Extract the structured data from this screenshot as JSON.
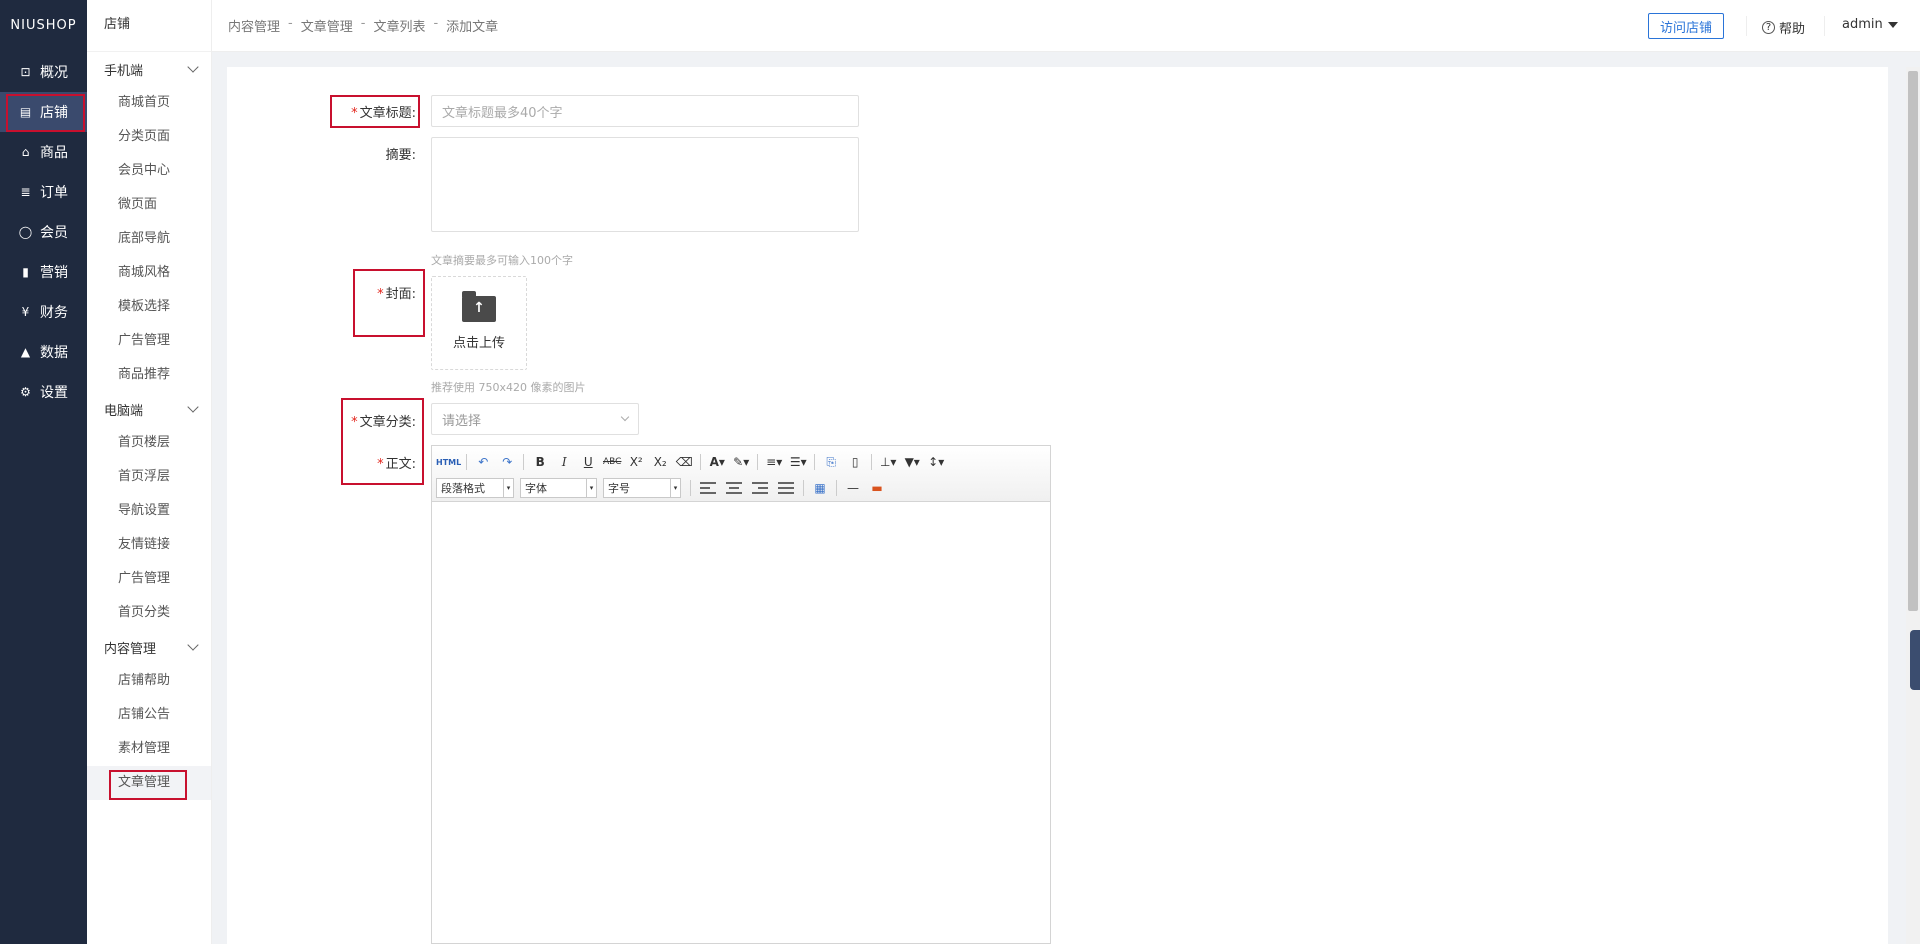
{
  "logo": "NIUSHOP",
  "main_nav": [
    {
      "label": "概况",
      "icon": "overview-icon",
      "glyph": "⊡"
    },
    {
      "label": "店铺",
      "icon": "store-icon",
      "glyph": "▤"
    },
    {
      "label": "商品",
      "icon": "goods-icon",
      "glyph": "⌂"
    },
    {
      "label": "订单",
      "icon": "order-icon",
      "glyph": "≣"
    },
    {
      "label": "会员",
      "icon": "member-icon",
      "glyph": "◯"
    },
    {
      "label": "营销",
      "icon": "marketing-icon",
      "glyph": "▮"
    },
    {
      "label": "财务",
      "icon": "finance-icon",
      "glyph": "¥"
    },
    {
      "label": "数据",
      "icon": "data-icon",
      "glyph": "▲"
    },
    {
      "label": "设置",
      "icon": "settings-icon",
      "glyph": "⚙"
    }
  ],
  "subnav": {
    "title": "店铺",
    "groups": [
      {
        "label": "手机端",
        "items": [
          "商城首页",
          "分类页面",
          "会员中心",
          "微页面",
          "底部导航",
          "商城风格",
          "模板选择",
          "广告管理",
          "商品推荐"
        ]
      },
      {
        "label": "电脑端",
        "items": [
          "首页楼层",
          "首页浮层",
          "导航设置",
          "友情链接",
          "广告管理",
          "首页分类"
        ]
      },
      {
        "label": "内容管理",
        "items": [
          "店铺帮助",
          "店铺公告",
          "素材管理",
          "文章管理"
        ]
      }
    ]
  },
  "header": {
    "breadcrumbs": [
      "内容管理",
      "文章管理",
      "文章列表",
      "添加文章"
    ],
    "separator": "-",
    "visit_store": "访问店铺",
    "help": "帮助",
    "user": "admin"
  },
  "form": {
    "title_label": "文章标题:",
    "title_placeholder": "文章标题最多40个字",
    "summary_label": "摘要:",
    "summary_hint": "文章摘要最多可输入100个字",
    "cover_label": "封面:",
    "upload_label": "点击上传",
    "cover_hint": "推荐使用 750x420 像素的图片",
    "category_label": "文章分类:",
    "category_placeholder": "请选择",
    "body_label": "正文:",
    "required_mark": "*"
  },
  "editor": {
    "html_btn": "HTML",
    "combo_paragraph": "段落格式",
    "combo_font": "字体",
    "combo_size": "字号"
  },
  "colors": {
    "sidebar_bg": "#1f2a3f",
    "accent_blue": "#2a74d8",
    "required_red": "#e2231a",
    "highlight_red": "#c8102e"
  }
}
